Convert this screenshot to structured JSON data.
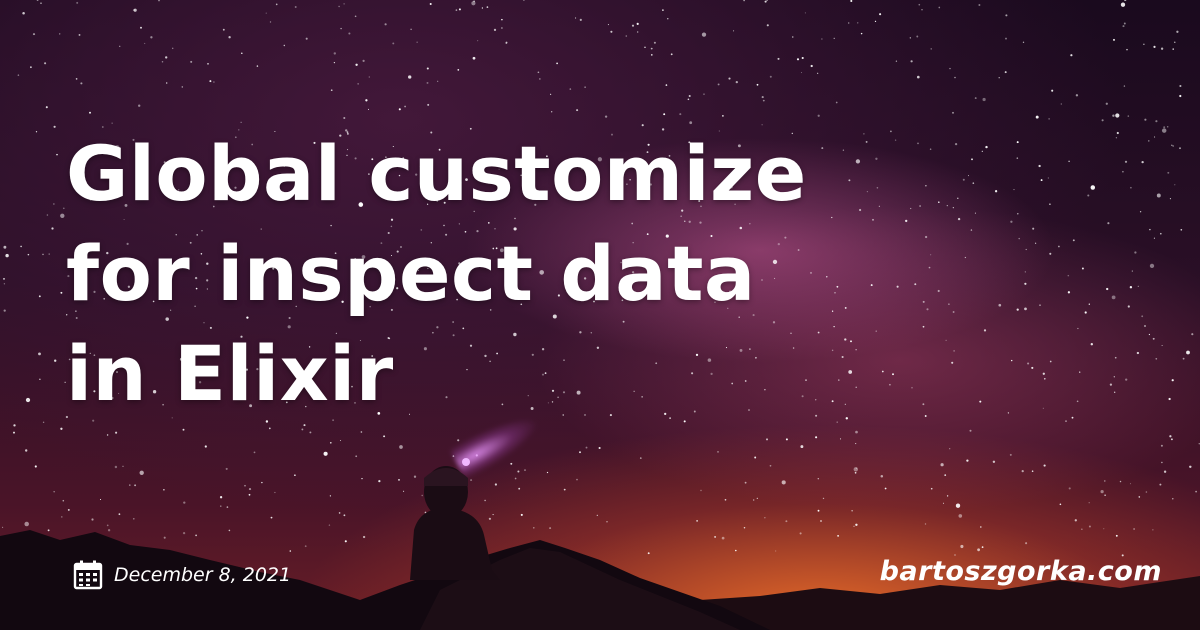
{
  "post": {
    "title_lines": [
      "Global customize",
      "for inspect data",
      "in Elixir"
    ],
    "date": "December 8, 2021",
    "date_icon": "calendar-icon",
    "site": "bartoszgorka.com"
  },
  "colors": {
    "text": "#ffffff",
    "sky_dark": "#1a0a1e",
    "milky_way": "#c85a96",
    "horizon_glow": "#eb6e28"
  }
}
